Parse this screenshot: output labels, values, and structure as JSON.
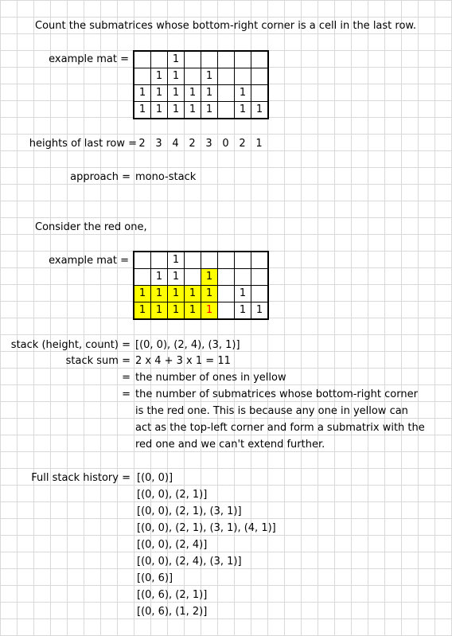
{
  "title": "Count the submatrices whose bottom-right corner is a cell in the last row.",
  "example_label": "example mat =",
  "matrix1": [
    [
      "",
      "",
      "1",
      "",
      "",
      "",
      "",
      ""
    ],
    [
      "",
      "1",
      "1",
      "",
      "1",
      "",
      "",
      ""
    ],
    [
      "1",
      "1",
      "1",
      "1",
      "1",
      "",
      "1",
      ""
    ],
    [
      "1",
      "1",
      "1",
      "1",
      "1",
      "",
      "1",
      "1"
    ]
  ],
  "heights_label": "heights of last row =",
  "heights": [
    "2",
    "3",
    "4",
    "2",
    "3",
    "0",
    "2",
    "1"
  ],
  "approach_label": "approach =",
  "approach_value": "mono-stack",
  "consider_text": "Consider the red one,",
  "matrix2": [
    [
      "",
      "",
      "1",
      "",
      "",
      "",
      "",
      ""
    ],
    [
      "",
      "1",
      "1",
      "",
      "1",
      "",
      "",
      ""
    ],
    [
      "1",
      "1",
      "1",
      "1",
      "1",
      "",
      "1",
      ""
    ],
    [
      "1",
      "1",
      "1",
      "1",
      "1",
      "",
      "1",
      "1"
    ]
  ],
  "stack_label": "stack (height, count) =",
  "stack_value": "[(0, 0), (2, 4), (3, 1)]",
  "stack_sum_label": "stack sum =",
  "stack_sum_value": "2 x 4 + 3 x 1 = 11",
  "eq1": "=",
  "eq1_text": "the number of ones in yellow",
  "eq2": "=",
  "eq2_lines": [
    "the number of submatrices whose bottom-right corner",
    "is the red one. This is because any one in yellow can",
    "act as the top-left corner and form a submatrix with the",
    "red one and we can't extend further."
  ],
  "history_label": "Full stack history =",
  "history": [
    "[(0, 0)]",
    "[(0, 0), (2, 1)]",
    "[(0, 0), (2, 1), (3, 1)]",
    "[(0, 0), (2, 1), (3, 1), (4, 1)]",
    "[(0, 0), (2, 4)]",
    "[(0, 0), (2, 4), (3, 1)]",
    "[(0, 6)]",
    "[(0, 6), (2, 1)]",
    "[(0, 6), (1, 2)]"
  ],
  "colors": {
    "highlight": "#ffff00",
    "red": "#ff0000",
    "grid": "#d9d9d9"
  }
}
